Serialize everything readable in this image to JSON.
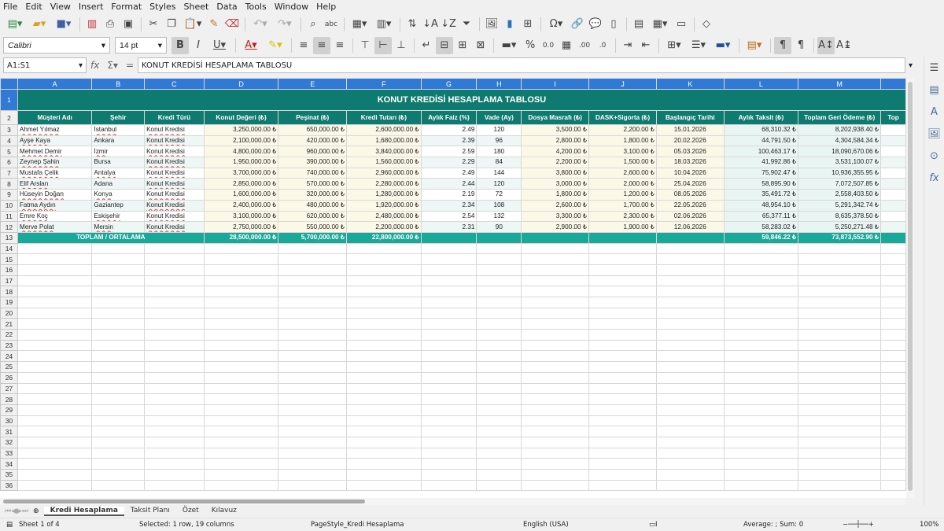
{
  "menu": [
    "File",
    "Edit",
    "View",
    "Insert",
    "Format",
    "Styles",
    "Sheet",
    "Data",
    "Tools",
    "Window",
    "Help"
  ],
  "toolbar": {
    "font_name": "Calibri",
    "font_size": "14 pt"
  },
  "formula": {
    "namebox": "A1:S1",
    "content": "KONUT KREDİSİ HESAPLAMA TABLOSU"
  },
  "columns": [
    "A",
    "B",
    "C",
    "D",
    "E",
    "F",
    "G",
    "H",
    "I",
    "J",
    "K",
    "L",
    "M",
    ""
  ],
  "sheet_title": "KONUT KREDİSİ HESAPLAMA TABLOSU",
  "headers": [
    "Müşteri Adı",
    "Şehir",
    "Kredi Türü",
    "Konut Değeri (₺)",
    "Peşinat (₺)",
    "Kredi Tutarı (₺)",
    "Aylık Faiz (%)",
    "Vade (Ay)",
    "Dosya Masrafı (₺)",
    "DASK+Sigorta (₺)",
    "Başlangıç Tarihi",
    "Aylık Taksit (₺)",
    "Toplam Geri Ödeme (₺)",
    "Top"
  ],
  "rows": [
    [
      "Ahmet Yılmaz",
      "İstanbul",
      "Konut Kredisi",
      "3,250,000.00 ₺",
      "650,000.00 ₺",
      "2,600,000.00 ₺",
      "2.49",
      "120",
      "3,500.00 ₺",
      "2,200.00 ₺",
      "15.01.2026",
      "68,310.32 ₺",
      "8,202,938.40 ₺"
    ],
    [
      "Ayşe Kaya",
      "Ankara",
      "Konut Kredisi",
      "2,100,000.00 ₺",
      "420,000.00 ₺",
      "1,680,000.00 ₺",
      "2.39",
      "96",
      "2,800.00 ₺",
      "1,800.00 ₺",
      "20.02.2026",
      "44,791.50 ₺",
      "4,304,584.34 ₺"
    ],
    [
      "Mehmet Demir",
      "İzmir",
      "Konut Kredisi",
      "4,800,000.00 ₺",
      "960,000.00 ₺",
      "3,840,000.00 ₺",
      "2.59",
      "180",
      "4,200.00 ₺",
      "3,100.00 ₺",
      "05.03.2026",
      "100,463.17 ₺",
      "18,090,670.06 ₺"
    ],
    [
      "Zeynep Şahin",
      "Bursa",
      "Konut Kredisi",
      "1,950,000.00 ₺",
      "390,000.00 ₺",
      "1,560,000.00 ₺",
      "2.29",
      "84",
      "2,200.00 ₺",
      "1,500.00 ₺",
      "18.03.2026",
      "41,992.86 ₺",
      "3,531,100.07 ₺"
    ],
    [
      "Mustafa Çelik",
      "Antalya",
      "Konut Kredisi",
      "3,700,000.00 ₺",
      "740,000.00 ₺",
      "2,960,000.00 ₺",
      "2.49",
      "144",
      "3,800.00 ₺",
      "2,600.00 ₺",
      "10.04.2026",
      "75,902.47 ₺",
      "10,936,355.95 ₺"
    ],
    [
      "Elif Arslan",
      "Adana",
      "Konut Kredisi",
      "2,850,000.00 ₺",
      "570,000.00 ₺",
      "2,280,000.00 ₺",
      "2.44",
      "120",
      "3,000.00 ₺",
      "2,000.00 ₺",
      "25.04.2026",
      "58,895.90 ₺",
      "7,072,507.85 ₺"
    ],
    [
      "Hüseyin Doğan",
      "Konya",
      "Konut Kredisi",
      "1,600,000.00 ₺",
      "320,000.00 ₺",
      "1,280,000.00 ₺",
      "2.19",
      "72",
      "1,800.00 ₺",
      "1,200.00 ₺",
      "08.05.2026",
      "35,491.72 ₺",
      "2,558,403.50 ₺"
    ],
    [
      "Fatma Aydın",
      "Gaziantep",
      "Konut Kredisi",
      "2,400,000.00 ₺",
      "480,000.00 ₺",
      "1,920,000.00 ₺",
      "2.34",
      "108",
      "2,600.00 ₺",
      "1,700.00 ₺",
      "22.05.2026",
      "48,954.10 ₺",
      "5,291,342.74 ₺"
    ],
    [
      "Emre Koç",
      "Eskişehir",
      "Konut Kredisi",
      "3,100,000.00 ₺",
      "620,000.00 ₺",
      "2,480,000.00 ₺",
      "2.54",
      "132",
      "3,300.00 ₺",
      "2,300.00 ₺",
      "02.06.2026",
      "65,377.11 ₺",
      "8,635,378.50 ₺"
    ],
    [
      "Merve Polat",
      "Mersin",
      "Konut Kredisi",
      "2,750,000.00 ₺",
      "550,000.00 ₺",
      "2,200,000.00 ₺",
      "2.31",
      "90",
      "2,900.00 ₺",
      "1,900.00 ₺",
      "12.06.2026",
      "58,283.02 ₺",
      "5,250,271.48 ₺"
    ]
  ],
  "total": {
    "label": "TOPLAM / ORTALAMA",
    "konut": "28,500,000.00 ₺",
    "pesinat": "5,700,000.00 ₺",
    "kredi": "22,800,000.00 ₺",
    "taksit": "59,846.22 ₺",
    "geri": "73,873,552.90 ₺"
  },
  "tabs": [
    "Kredi Hesaplama",
    "Taksit Planı",
    "Özet",
    "Kılavuz"
  ],
  "status": {
    "sheet": "Sheet 1 of 4",
    "selected": "Selected: 1 row, 19 columns",
    "pagestyle": "PageStyle_Kredi Hesaplama",
    "lang": "English (USA)",
    "sum": "Average: ; Sum: 0",
    "zoom": "100%"
  }
}
